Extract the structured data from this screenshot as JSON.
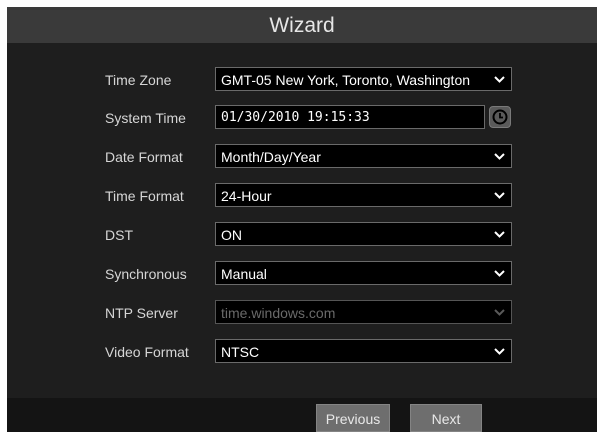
{
  "window": {
    "title": "Wizard"
  },
  "fields": {
    "time_zone": {
      "label": "Time Zone",
      "value": "GMT-05 New York, Toronto, Washington"
    },
    "system_time": {
      "label": "System Time",
      "value": "01/30/2010 19:15:33"
    },
    "date_format": {
      "label": "Date Format",
      "value": "Month/Day/Year"
    },
    "time_format": {
      "label": "Time Format",
      "value": "24-Hour"
    },
    "dst": {
      "label": "DST",
      "value": "ON"
    },
    "synchronous": {
      "label": "Synchronous",
      "value": "Manual"
    },
    "ntp_server": {
      "label": "NTP Server",
      "value": "time.windows.com",
      "disabled": true
    },
    "video_format": {
      "label": "Video Format",
      "value": "NTSC"
    }
  },
  "footer": {
    "previous_label": "Previous",
    "next_label": "Next"
  },
  "icons": {
    "clock": "clock-icon",
    "dropdown": "chevron-down-icon"
  },
  "colors": {
    "background": "#1e1e1e",
    "titlebar": "#3a3a3a",
    "button": "#6e6e6e"
  }
}
